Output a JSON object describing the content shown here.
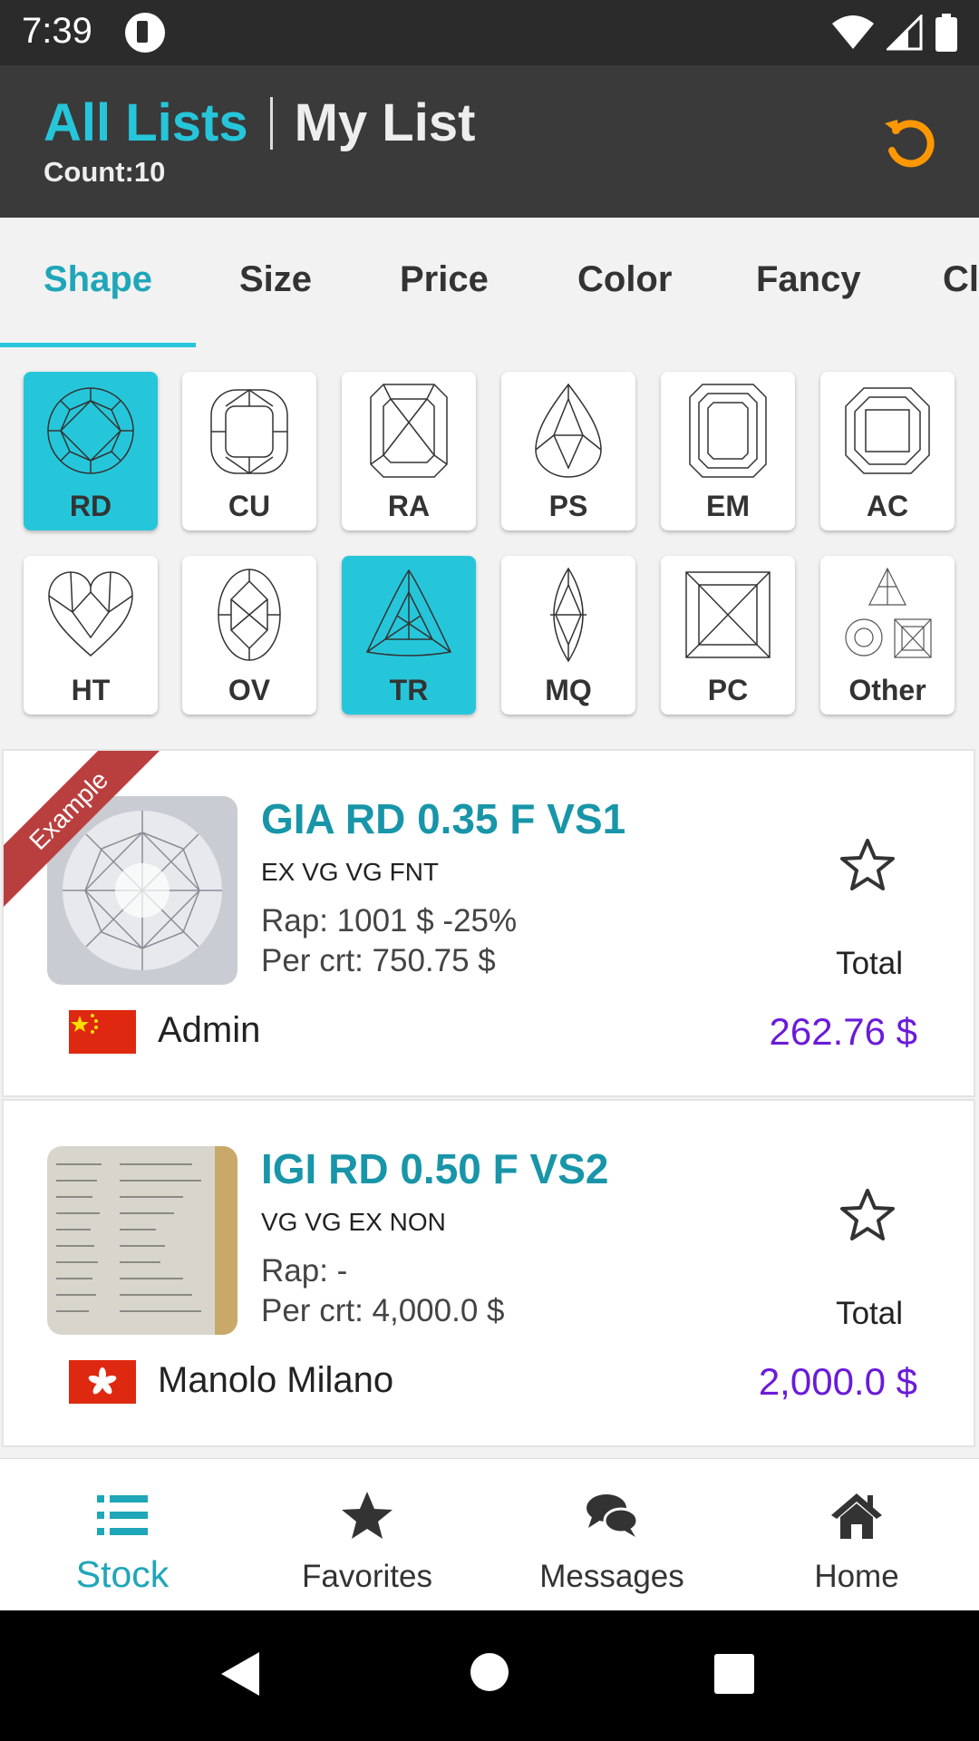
{
  "status_bar": {
    "time": "7:39"
  },
  "header": {
    "all_lists": "All Lists",
    "my_list": "My List",
    "count": "Count:10"
  },
  "tabs": [
    {
      "label": "Shape",
      "active": true
    },
    {
      "label": "Size"
    },
    {
      "label": "Price"
    },
    {
      "label": "Color"
    },
    {
      "label": "Fancy"
    },
    {
      "label": "Cl"
    }
  ],
  "shapes": [
    {
      "code": "RD",
      "selected": true
    },
    {
      "code": "CU"
    },
    {
      "code": "RA"
    },
    {
      "code": "PS"
    },
    {
      "code": "EM"
    },
    {
      "code": "AC"
    },
    {
      "code": "HT"
    },
    {
      "code": "OV"
    },
    {
      "code": "TR",
      "selected": true
    },
    {
      "code": "MQ"
    },
    {
      "code": "PC"
    },
    {
      "code": "Other"
    }
  ],
  "listings": [
    {
      "ribbon": "Example",
      "title": "GIA RD 0.35 F VS1",
      "grades": "EX VG VG FNT",
      "rap": "Rap: 1001 $ -25%",
      "per_crt": "Per crt: 750.75 $",
      "total_label": "Total",
      "price": "262.76 $",
      "seller": "Admin",
      "flag": "china"
    },
    {
      "title": "IGI RD 0.50 F VS2",
      "grades": "VG VG EX NON",
      "rap": "Rap: -",
      "per_crt": "Per crt: 4,000.0 $",
      "total_label": "Total",
      "price": "2,000.0 $",
      "seller": "Manolo Milano",
      "flag": "hong-kong"
    }
  ],
  "bottom_nav": [
    {
      "label": "Stock",
      "icon": "list-icon",
      "active": true
    },
    {
      "label": "Favorites",
      "icon": "star-icon"
    },
    {
      "label": "Messages",
      "icon": "chat-icon"
    },
    {
      "label": "Home",
      "icon": "home-icon"
    }
  ],
  "colors": {
    "accent": "#26c6da",
    "price": "#6a1bd8",
    "refresh": "#ff9800",
    "ribbon": "#b93f3f"
  }
}
